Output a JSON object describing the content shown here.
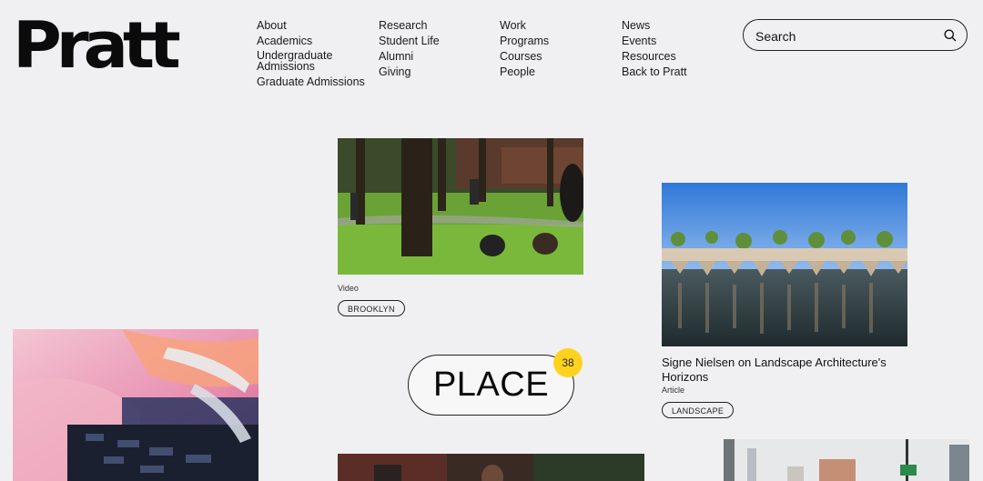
{
  "logo": {
    "text": "Pratt"
  },
  "nav": {
    "col1": [
      "About",
      "Academics",
      "Undergraduate Admissions",
      "Graduate Admissions"
    ],
    "col2": [
      "Research",
      "Student Life",
      "Alumni",
      "Giving"
    ],
    "col3": [
      "Work",
      "Programs",
      "Courses",
      "People"
    ],
    "col4": [
      "News",
      "Events",
      "Resources",
      "Back to Pratt"
    ]
  },
  "search": {
    "placeholder": "Search"
  },
  "cards": {
    "video": {
      "type": "Video",
      "tag": "BROOKLYN"
    },
    "article": {
      "title": "Signe Nielsen on Landscape Architecture's Horizons",
      "type": "Article",
      "tag": "LANDSCAPE"
    }
  },
  "place": {
    "label": "PLACE",
    "count": "38"
  },
  "colors": {
    "background": "#f0f0f2",
    "badge": "#ffd21f",
    "text": "#111111"
  }
}
